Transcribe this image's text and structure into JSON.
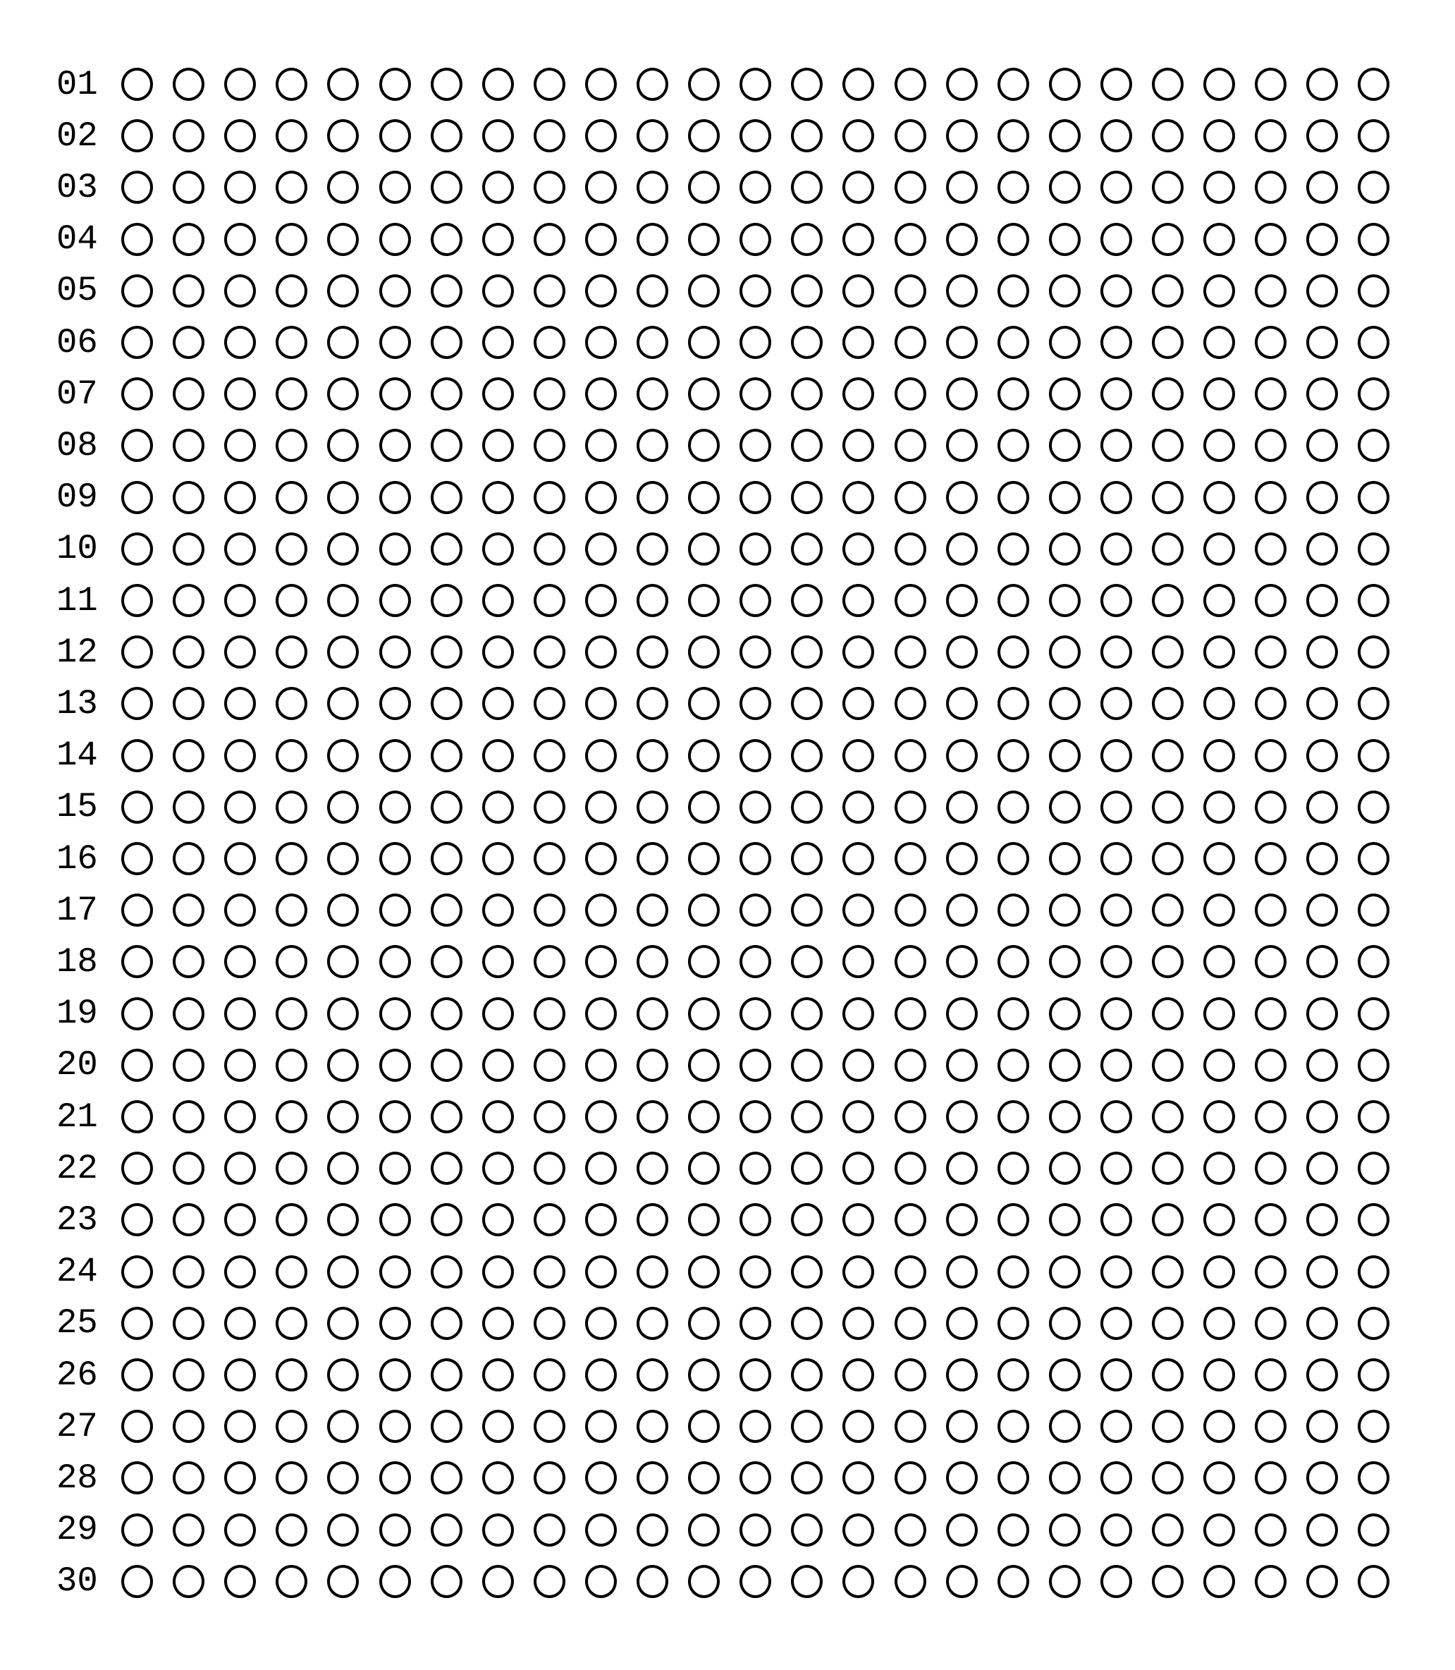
{
  "sheet": {
    "title": "",
    "bubbles_per_row": 25,
    "ink_color": "#000000",
    "paper_color": "#ffffff",
    "rows": [
      {
        "label": "01"
      },
      {
        "label": "02"
      },
      {
        "label": "03"
      },
      {
        "label": "04"
      },
      {
        "label": "05"
      },
      {
        "label": "06"
      },
      {
        "label": "07"
      },
      {
        "label": "08"
      },
      {
        "label": "09"
      },
      {
        "label": "10"
      },
      {
        "label": "11"
      },
      {
        "label": "12"
      },
      {
        "label": "13"
      },
      {
        "label": "14"
      },
      {
        "label": "15"
      },
      {
        "label": "16"
      },
      {
        "label": "17"
      },
      {
        "label": "18"
      },
      {
        "label": "19"
      },
      {
        "label": "20"
      },
      {
        "label": "21"
      },
      {
        "label": "22"
      },
      {
        "label": "23"
      },
      {
        "label": "24"
      },
      {
        "label": "25"
      },
      {
        "label": "26"
      },
      {
        "label": "27"
      },
      {
        "label": "28"
      },
      {
        "label": "29"
      },
      {
        "label": "30"
      }
    ],
    "filled_bubbles": []
  }
}
